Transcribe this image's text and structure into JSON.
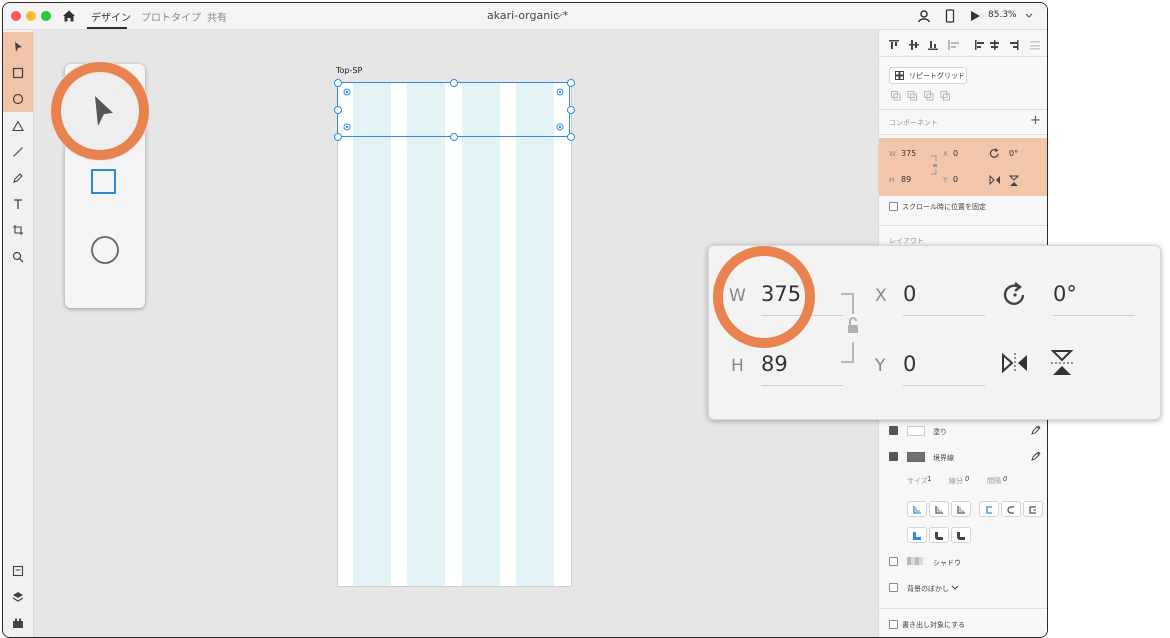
{
  "tabs": [
    {
      "label": "デザイン"
    },
    {
      "label": "プロトタイプ"
    },
    {
      "label": "共有"
    }
  ],
  "document_title": "akari-organic *",
  "zoom_level": "85.3%",
  "artboard": {
    "label": "Top-SP"
  },
  "panel": {
    "repeat_grid_label": "リピートグリッド",
    "component_label": "コンポーネント",
    "props": {
      "w_label": "W",
      "w_value": "375",
      "h_label": "H",
      "h_value": "89",
      "x_label": "X",
      "x_value": "0",
      "y_label": "Y",
      "y_value": "0",
      "rotation_value": "0°"
    },
    "fix_on_scroll_label": "スクロール時に位置を固定",
    "layout_label": "レイアウト",
    "fill_label": "塗り",
    "border_label": "境界線",
    "size_label": "サイズ",
    "size_value": "1",
    "dash_label": "線分",
    "dash_value": "0",
    "gap_label": "間隔",
    "gap_value": "0",
    "shadow_label": "シャドウ",
    "background_blur_label": "背景のぼかし",
    "export_label": "書き出し対象にする"
  },
  "zoom_callout": {
    "w_label": "W",
    "w_value": "375",
    "h_label": "H",
    "h_value": "89",
    "x_label": "X",
    "x_value": "0",
    "y_label": "Y",
    "y_value": "0",
    "rotation_value": "0°"
  },
  "colors": {
    "highlight": "#f1c6a9",
    "circle": "#e8834f",
    "selection": "#2d8ceb",
    "grid_column": "#e4f3f5"
  }
}
